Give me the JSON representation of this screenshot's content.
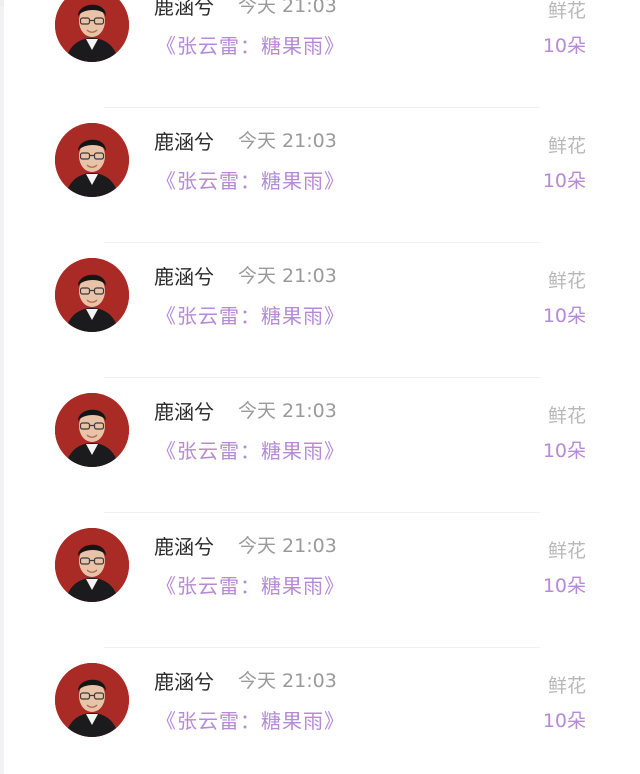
{
  "colors": {
    "accent": "#b58ad6",
    "name_text": "#2b2b2b",
    "muted_text": "#9a9a9a",
    "label_text": "#b8b8b8",
    "avatar_bg": "#b8302a"
  },
  "records": [
    {
      "user": "鹿涵兮",
      "time": "今天 21:03",
      "gift": "《张云雷：糖果雨》",
      "type": "鲜花",
      "amount": "10朵",
      "avatar": "avatar-photo"
    },
    {
      "user": "鹿涵兮",
      "time": "今天 21:03",
      "gift": "《张云雷：糖果雨》",
      "type": "鲜花",
      "amount": "10朵",
      "avatar": "avatar-photo"
    },
    {
      "user": "鹿涵兮",
      "time": "今天 21:03",
      "gift": "《张云雷：糖果雨》",
      "type": "鲜花",
      "amount": "10朵",
      "avatar": "avatar-photo"
    },
    {
      "user": "鹿涵兮",
      "time": "今天 21:03",
      "gift": "《张云雷：糖果雨》",
      "type": "鲜花",
      "amount": "10朵",
      "avatar": "avatar-photo"
    },
    {
      "user": "鹿涵兮",
      "time": "今天 21:03",
      "gift": "《张云雷：糖果雨》",
      "type": "鲜花",
      "amount": "10朵",
      "avatar": "avatar-photo"
    },
    {
      "user": "鹿涵兮",
      "time": "今天 21:03",
      "gift": "《张云雷：糖果雨》",
      "type": "鲜花",
      "amount": "10朵",
      "avatar": "avatar-photo"
    }
  ]
}
